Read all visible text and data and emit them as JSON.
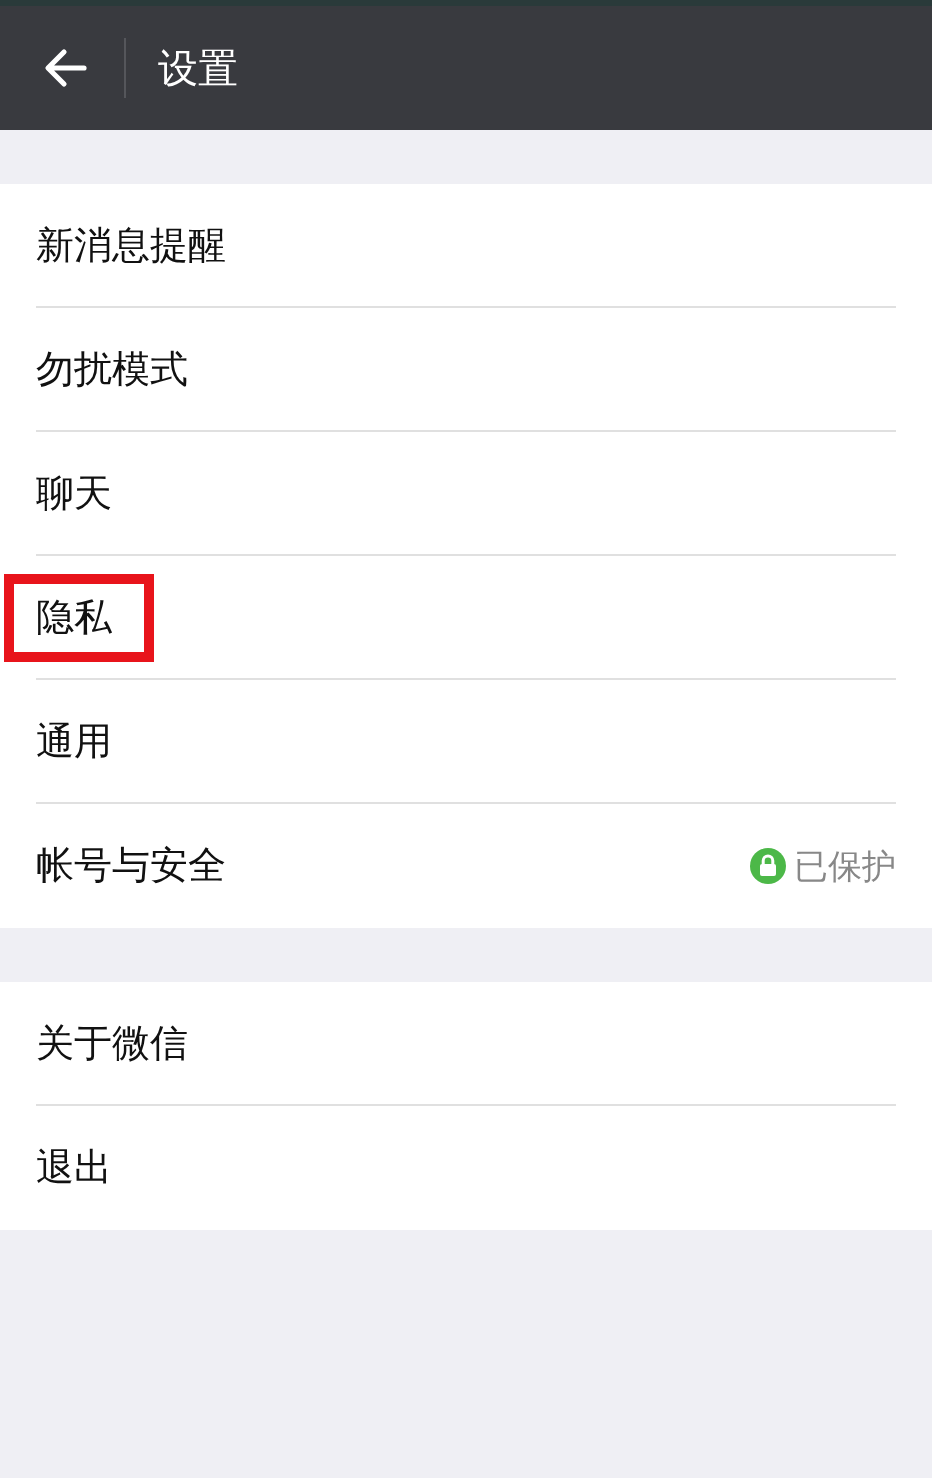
{
  "header": {
    "title": "设置"
  },
  "groups": [
    {
      "items": [
        {
          "label": "新消息提醒",
          "highlighted": false
        },
        {
          "label": "勿扰模式",
          "highlighted": false
        },
        {
          "label": "聊天",
          "highlighted": false
        },
        {
          "label": "隐私",
          "highlighted": true
        },
        {
          "label": "通用",
          "highlighted": false
        },
        {
          "label": "帐号与安全",
          "highlighted": false,
          "status": "已保护"
        }
      ]
    },
    {
      "items": [
        {
          "label": "关于微信",
          "highlighted": false
        },
        {
          "label": "退出",
          "highlighted": false
        }
      ]
    }
  ]
}
